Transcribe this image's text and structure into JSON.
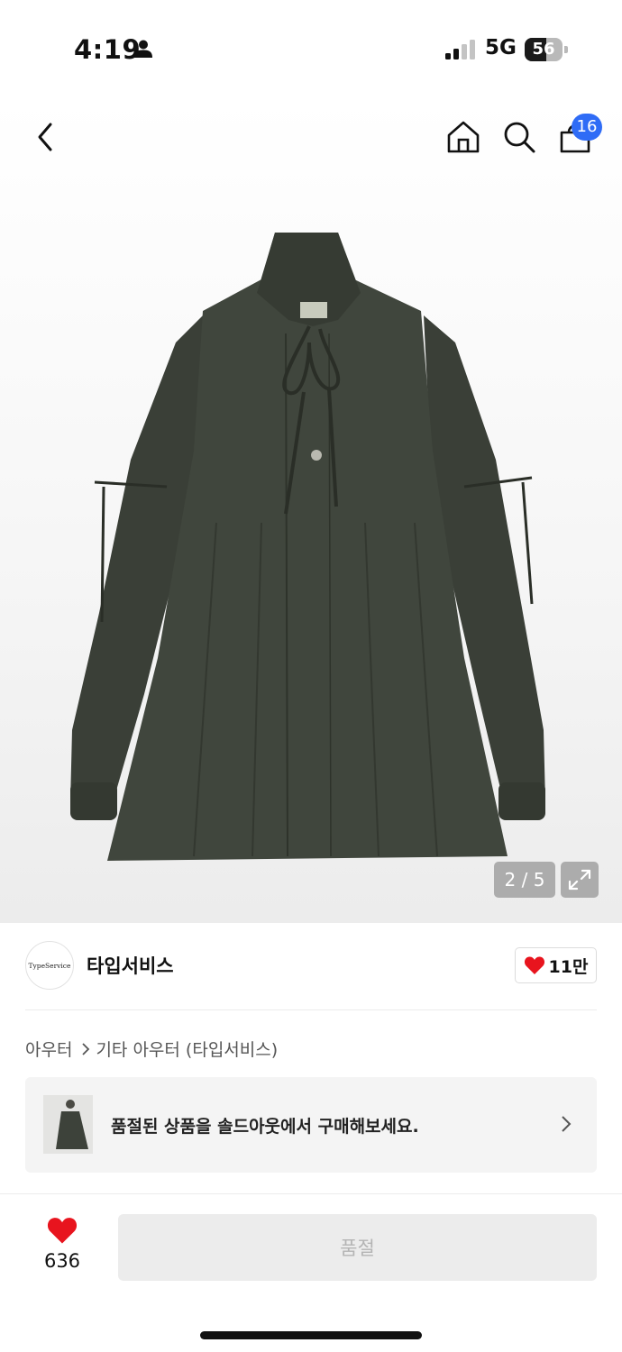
{
  "status_bar": {
    "time": "4:19",
    "network": "5G",
    "battery": "56",
    "battery_level": 0.56
  },
  "header": {
    "back_icon": "chevron-left-icon",
    "home_icon": "home-icon",
    "search_icon": "search-icon",
    "cart_icon": "shopping-bag-icon",
    "cart_badge": "16",
    "badge_color": "#2f6cf6"
  },
  "gallery": {
    "page_indicator": "2 / 5",
    "expand_icon": "expand-icon",
    "product_color": "#3b4038"
  },
  "brand": {
    "logo_text": "TypeService",
    "name": "타입서비스",
    "like_count": "11만",
    "heart_color": "#e8141e"
  },
  "breadcrumb": {
    "category": "아우터",
    "subcategory": "기타 아우터 (타입서비스)"
  },
  "soldout_banner": {
    "text": "품절된 상품을 솔드아웃에서 구매해보세요."
  },
  "bottom_bar": {
    "wish_count": "636",
    "buy_label": "품절"
  }
}
